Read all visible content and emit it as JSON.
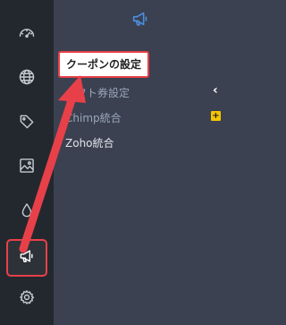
{
  "sidebar": {
    "items": [
      {
        "icon": "dashboard-gauge-icon"
      },
      {
        "icon": "globe-icon"
      },
      {
        "icon": "tag-icon"
      },
      {
        "icon": "image-icon"
      },
      {
        "icon": "droplet-icon"
      },
      {
        "icon": "megaphone-icon",
        "active": true
      },
      {
        "icon": "gear-icon"
      }
    ]
  },
  "submenu": {
    "header_icon": "megaphone-icon",
    "items": [
      {
        "label": "クーポンの設定",
        "highlighted": true
      },
      {
        "label": "ギフト券設定"
      },
      {
        "label": "Chimp統合"
      },
      {
        "label": "Zoho統合"
      }
    ],
    "collapse_symbol": "‹",
    "plus_badge": "+"
  },
  "colors": {
    "rail_bg": "#23282e",
    "panel_bg": "#3b4150",
    "accent": "#4a90e2",
    "annotation_red": "#e84049",
    "badge_yellow": "#f5c400"
  }
}
